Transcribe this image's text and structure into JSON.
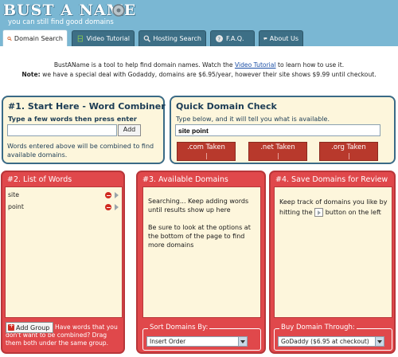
{
  "header": {
    "logo_title": "BUST A NAME",
    "logo_tagline": "you can still find good domains",
    "tabs": [
      {
        "label": "Domain Search",
        "icon": "magnifier-icon",
        "active": true
      },
      {
        "label": "Video Tutorial",
        "icon": "film-icon",
        "active": false
      },
      {
        "label": "Hosting Search",
        "icon": "magnifier-icon",
        "active": false
      },
      {
        "label": "F.A.Q.",
        "icon": "help-icon",
        "active": false
      },
      {
        "label": "About Us",
        "icon": "chat-icon",
        "active": false
      }
    ]
  },
  "intro": {
    "line1_before": "BustAName is a tool to help find domain names. Watch the ",
    "line1_link": "Video Tutorial",
    "line1_after": " to learn how to use it.",
    "note_label": "Note:",
    "note_text": " we have a special deal with Godaddy, domains are $6.95/year, however their site shows $9.99 until checkout."
  },
  "combiner": {
    "title": "#1. Start Here - Word Combiner",
    "prompt": "Type a few words then press enter",
    "input_value": "",
    "add_label": "Add",
    "note": "Words entered above will be combined to find available domains."
  },
  "quick_check": {
    "title": "Quick Domain Check",
    "prompt": "Type below, and it will tell you what is available.",
    "input_value": "site point",
    "results": [
      {
        "label": ".com Taken"
      },
      {
        "label": ".net Taken"
      },
      {
        "label": ".org Taken"
      }
    ]
  },
  "word_list": {
    "title": "#2. List of Words",
    "words": [
      "site",
      "point"
    ],
    "add_group_label": "Add Group",
    "help": "Have words that you don't want to be combined? Drag them both under the same group."
  },
  "available": {
    "title": "#3. Available Domains",
    "para1": "Searching... Keep adding words until results show up here",
    "para2": "Be sure to look at the options at the bottom of the page to find more domains",
    "sort_legend": "Sort Domains By:",
    "sort_value": "Insert Order"
  },
  "save": {
    "title": "#4. Save Domains for Review",
    "text_before": "Keep track of domains you like by hitting the ",
    "text_after": " button on the left",
    "buy_legend": "Buy Domain Through:",
    "buy_value": "GoDaddy ($6.95 at checkout)"
  },
  "colors": {
    "header_bg": "#7ab7d3",
    "tab_bg": "#3d6f86",
    "panel_border_blue": "#3a6a86",
    "panel_bg": "#fdf6dc",
    "panel_red": "#e0484b",
    "tld_taken": "#b8392c"
  }
}
